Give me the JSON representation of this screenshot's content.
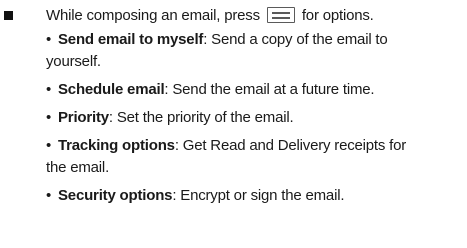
{
  "intro": {
    "before_icon": "While composing an email, press",
    "icon": "menu-key-icon",
    "after_icon": "for options."
  },
  "options": [
    {
      "bullet": "•",
      "term": "Send email to myself",
      "line1": ": Send a copy of the email to",
      "line2": "yourself."
    },
    {
      "bullet": "•",
      "term": "Schedule email",
      "line1": ": Send the email at a future time.",
      "line2": ""
    },
    {
      "bullet": "•",
      "term": "Priority",
      "line1": ": Set the priority of the email.",
      "line2": ""
    },
    {
      "bullet": "•",
      "term": "Tracking options",
      "line1": ": Get Read and Delivery receipts for",
      "line2": "the email."
    },
    {
      "bullet": "•",
      "term": "Security options",
      "line1": ": Encrypt or sign the email.",
      "line2": ""
    }
  ]
}
